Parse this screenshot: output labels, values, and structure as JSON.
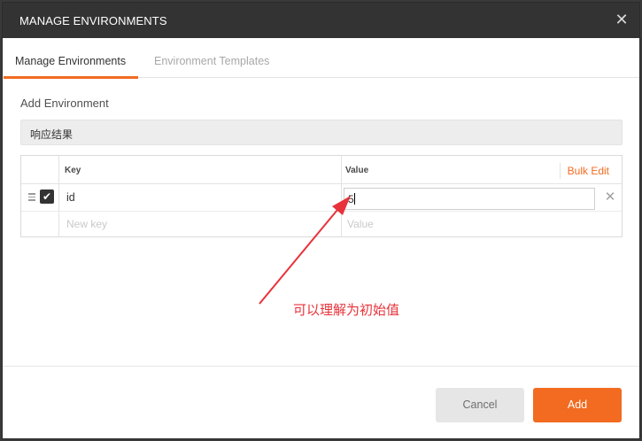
{
  "dialog": {
    "title": "MANAGE ENVIRONMENTS",
    "close_glyph": "✕"
  },
  "tabs": [
    {
      "label": "Manage Environments",
      "active": true
    },
    {
      "label": "Environment Templates",
      "active": false
    }
  ],
  "form": {
    "section_label": "Add Environment",
    "environment_name": "响应结果"
  },
  "table": {
    "headers": {
      "key": "Key",
      "value": "Value"
    },
    "bulk_edit_label": "Bulk Edit",
    "rows": [
      {
        "checked": true,
        "check_glyph": "✔",
        "key": "id",
        "value": "5",
        "delete_glyph": "✕"
      }
    ],
    "new_row": {
      "key_placeholder": "New key",
      "value_placeholder": "Value"
    }
  },
  "annotation": {
    "text": "可以理解为初始值",
    "color": "#e8323a"
  },
  "footer": {
    "cancel_label": "Cancel",
    "add_label": "Add"
  },
  "colors": {
    "accent": "#f26b21",
    "titlebar": "#333333"
  }
}
